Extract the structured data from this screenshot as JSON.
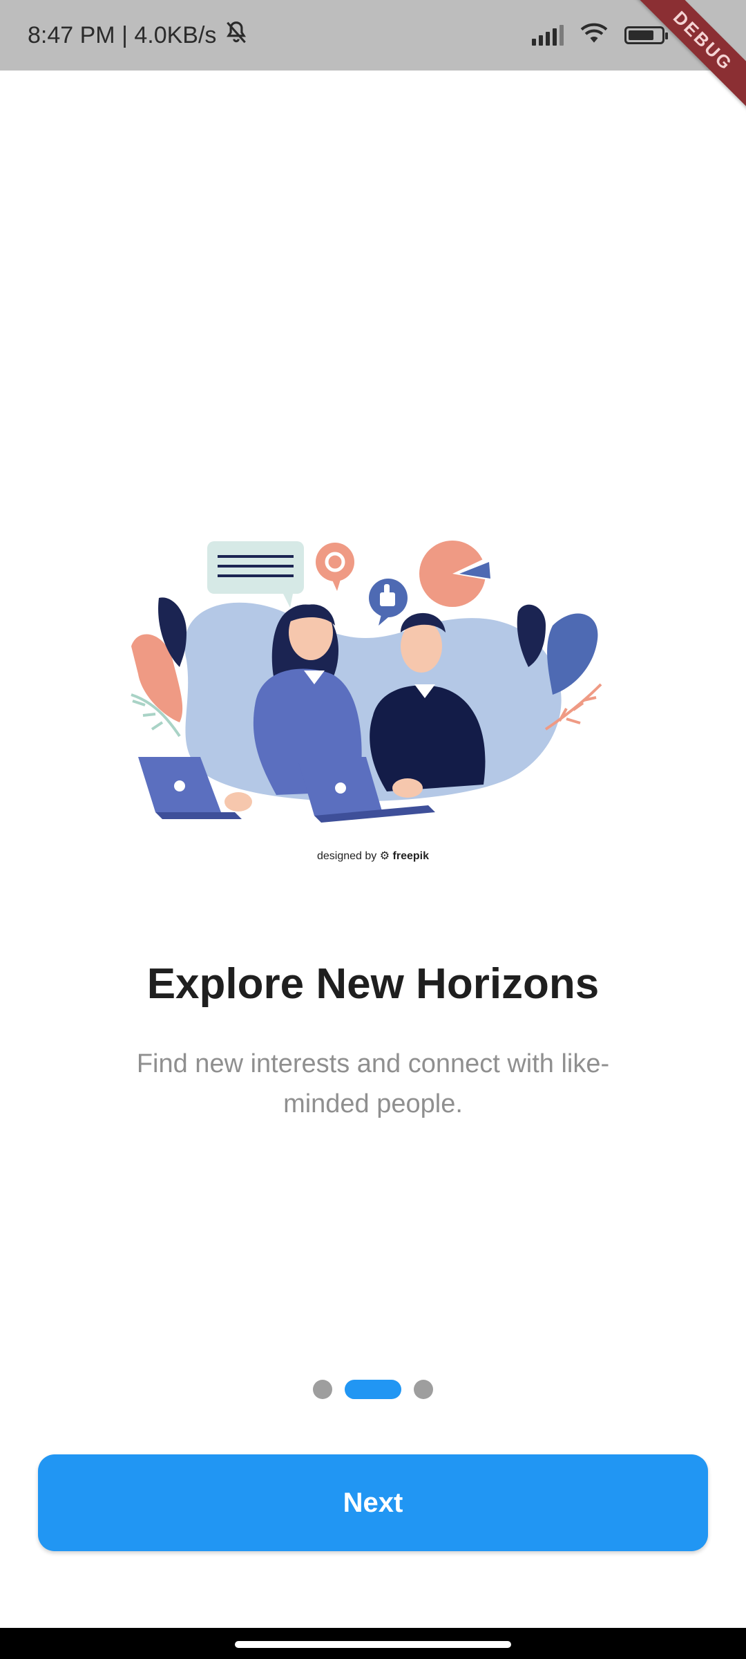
{
  "status_bar": {
    "time_speed": "8:47 PM | 4.0KB/s",
    "battery": "79"
  },
  "debug_banner": "DEBUG",
  "illustration": {
    "credit_prefix": "designed by",
    "credit_brand": "freepik"
  },
  "onboarding": {
    "title": "Explore New Horizons",
    "subtitle": "Find new interests and connect with like-minded people."
  },
  "pagination": {
    "total": 3,
    "active_index": 1
  },
  "actions": {
    "next_label": "Next"
  },
  "colors": {
    "accent": "#2196f3",
    "dot_inactive": "#9e9e9e"
  }
}
